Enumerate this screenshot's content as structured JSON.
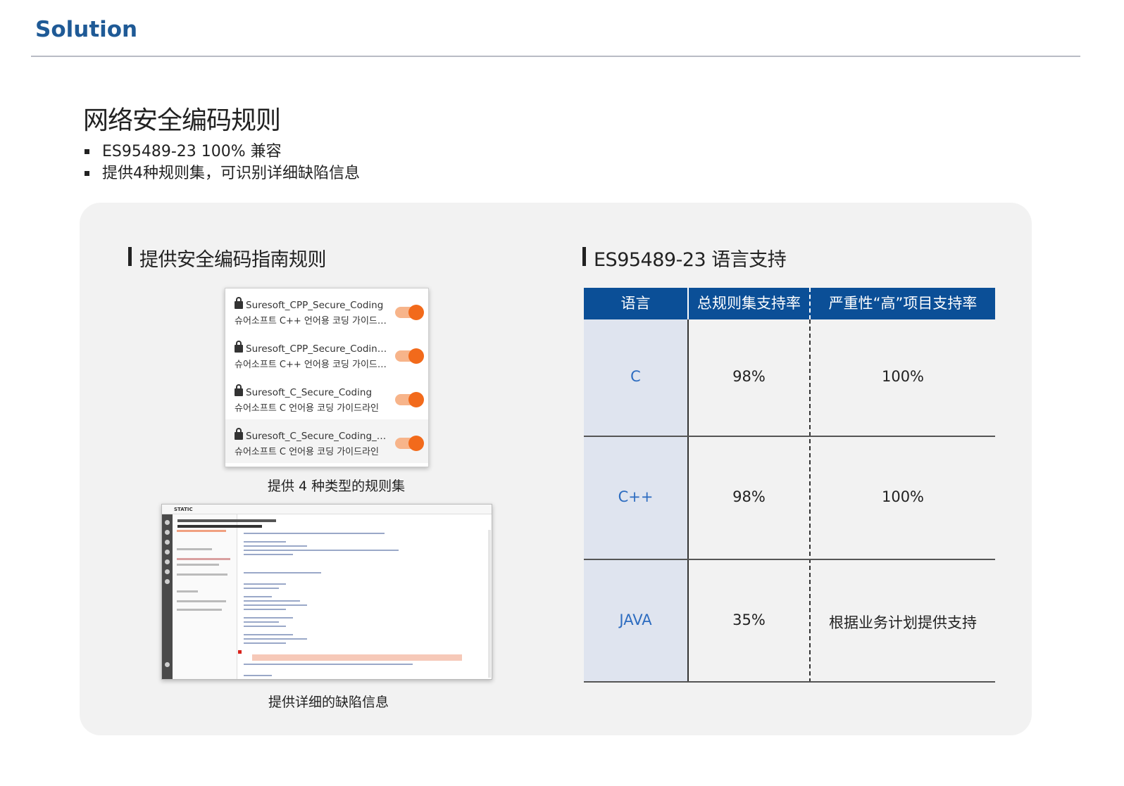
{
  "header": {
    "title": "Solution"
  },
  "page": {
    "title": "网络安全编码规则",
    "bullets": [
      "ES95489-23 100% 兼容",
      "提供4种规则集，可识别详细缺陷信息"
    ]
  },
  "left_section": {
    "heading": "提供安全编码指南规则",
    "rulesets": [
      {
        "name": "Suresoft_CPP_Secure_Coding",
        "desc": "슈어소프트 C++ 언어용 코딩 가이드라인",
        "enabled": true
      },
      {
        "name": "Suresoft_CPP_Secure_Coding_For...",
        "desc": "슈어소프트 C++ 언어용 코딩 가이드라인",
        "enabled": true
      },
      {
        "name": "Suresoft_C_Secure_Coding",
        "desc": "슈어소프트 C 언어용 코딩 가이드라인",
        "enabled": true
      },
      {
        "name": "Suresoft_C_Secure_Coding_For...",
        "desc": "슈어소프트 C 언어용 코딩 가이드라인",
        "enabled": true
      }
    ],
    "ruleset_caption": "提供 4 种类型的规则集",
    "defect_caption": "提供详细的缺陷信息",
    "defect_screenshot": {
      "app_name": "STATIC"
    }
  },
  "right_section": {
    "heading": "ES95489-23 语言支持",
    "table": {
      "headers": [
        "语言",
        "总规则集支持率",
        "严重性“高”项目支持率"
      ],
      "rows": [
        {
          "language": "C",
          "overall": "98%",
          "high": "100%"
        },
        {
          "language": "C++",
          "overall": "98%",
          "high": "100%"
        },
        {
          "language": "JAVA",
          "overall": "35%",
          "high": "根据业务计划提供支持"
        }
      ]
    }
  },
  "colors": {
    "header_title": "#1f5a96",
    "table_header_bg": "#0b4f97",
    "language_text": "#2d6cc0",
    "toggle_on": "#f26a1b",
    "panel_bg": "#f2f2f2"
  }
}
